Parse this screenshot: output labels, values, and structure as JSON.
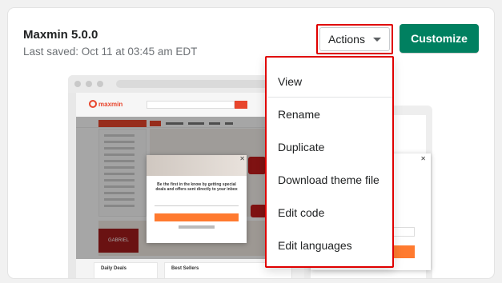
{
  "theme": {
    "name": "Maxmin 5.0.0",
    "last_saved": "Last saved: Oct 11 at 03:45 am EDT"
  },
  "toolbar": {
    "actions_label": "Actions",
    "customize_label": "Customize"
  },
  "preview": {
    "logo_text": "maxmin",
    "popup_text": "Be the first in the know by getting special deals and offers sent directly to your inbox",
    "sidebar_title": "Daily Deals",
    "sellers_title": "Best Sellers",
    "gabriel_text": "GABRIEL"
  },
  "actions_menu": {
    "items": [
      {
        "label": "View"
      },
      {
        "label": "Rename"
      },
      {
        "label": "Duplicate"
      },
      {
        "label": "Download theme file"
      },
      {
        "label": "Edit code"
      },
      {
        "label": "Edit languages"
      }
    ]
  },
  "colors": {
    "primary": "#008060",
    "highlight": "#e00000",
    "brand_orange": "#e8452c"
  },
  "icons": {
    "actions_caret": "chevron-down-icon",
    "popup_close": "close-icon"
  }
}
